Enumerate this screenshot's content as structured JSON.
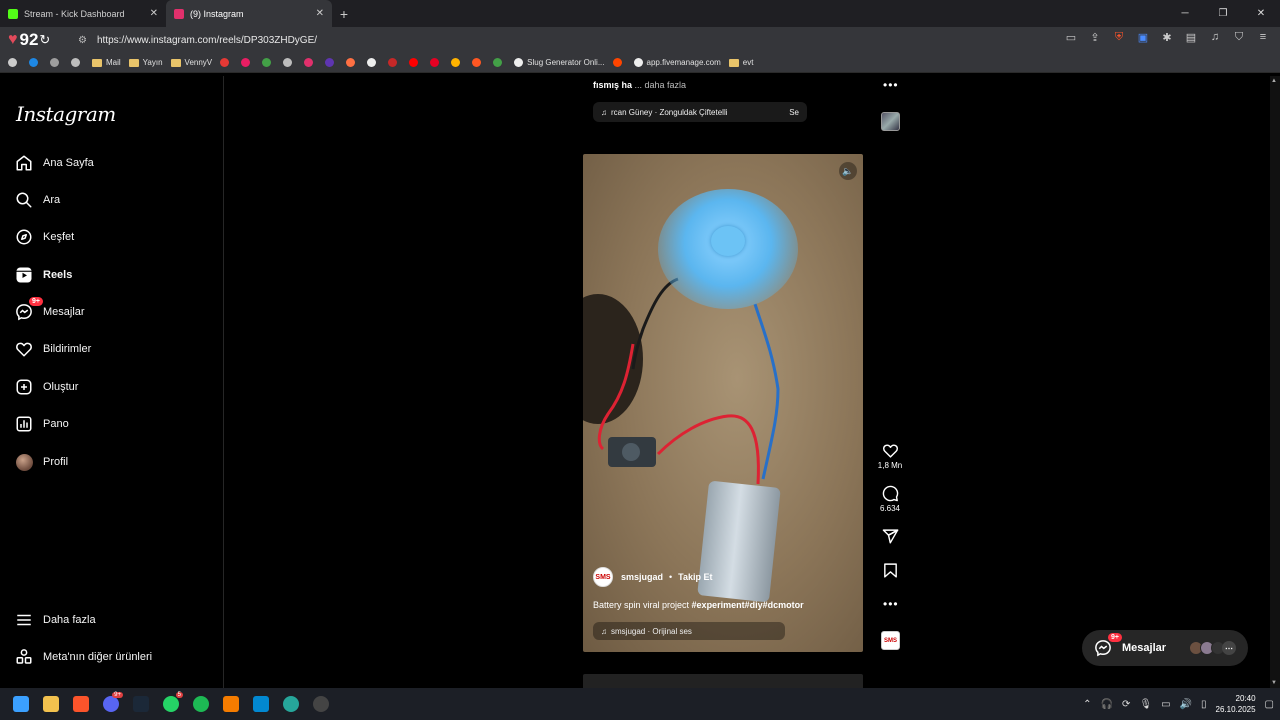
{
  "browser": {
    "tabs": [
      {
        "title": "Stream - Kick Dashboard",
        "favicon_color": "#53fc18",
        "active": false
      },
      {
        "title": "(9) Instagram",
        "favicon_color": "#e1306c",
        "active": true
      }
    ],
    "new_tab_label": "+",
    "shields_count": "92",
    "url": "https://www.instagram.com/reels/DP303ZHDyGE/",
    "bookmarks": [
      {
        "label": "",
        "icon": "apps-grid-icon",
        "color": "#cccccc"
      },
      {
        "label": "",
        "icon": "zte-icon",
        "color": "#1e88e5"
      },
      {
        "label": "",
        "icon": "play-icon",
        "color": "#9e9e9e"
      },
      {
        "label": "",
        "icon": "chrome-icon",
        "color": "#bdbdbd"
      },
      {
        "label": "Mail",
        "icon": "folder-icon",
        "color": "#e9c46a"
      },
      {
        "label": "Yayın",
        "icon": "folder-icon",
        "color": "#e9c46a"
      },
      {
        "label": "VennyV",
        "icon": "folder-icon",
        "color": "#e9c46a"
      },
      {
        "label": "",
        "icon": "a-icon",
        "color": "#e53935"
      },
      {
        "label": "",
        "icon": "bi-icon",
        "color": "#e91e63"
      },
      {
        "label": "",
        "icon": "plus-icon",
        "color": "#43a047"
      },
      {
        "label": "",
        "icon": "gamepad-icon",
        "color": "#bdbdbd"
      },
      {
        "label": "",
        "icon": "instagram-icon",
        "color": "#e1306c"
      },
      {
        "label": "",
        "icon": "circle-icon",
        "color": "#5e35b1"
      },
      {
        "label": "",
        "icon": "soundcloud-icon",
        "color": "#ff7043"
      },
      {
        "label": "",
        "icon": "x-icon",
        "color": "#eeeeee"
      },
      {
        "label": "",
        "icon": "bookmark-icon",
        "color": "#c62828"
      },
      {
        "label": "",
        "icon": "youtube-icon",
        "color": "#ff0000"
      },
      {
        "label": "",
        "icon": "pinterest-icon",
        "color": "#e60023"
      },
      {
        "label": "",
        "icon": "a-circle-icon",
        "color": "#ffb300"
      },
      {
        "label": "",
        "icon": "orange-icon",
        "color": "#ff5722"
      },
      {
        "label": "",
        "icon": "xbox-icon",
        "color": "#43a047"
      },
      {
        "label": "Slug Generator Onli...",
        "icon": "slug-icon",
        "color": "#eeeeee"
      },
      {
        "label": "",
        "icon": "reddit-icon",
        "color": "#ff4500"
      },
      {
        "label": "app.fivemanage.com",
        "icon": "fivemanage-icon",
        "color": "#eeeeee"
      },
      {
        "label": "evt",
        "icon": "folder-icon",
        "color": "#e9c46a"
      }
    ]
  },
  "sidebar": {
    "logo": "Instagram",
    "items": [
      {
        "label": "Ana Sayfa",
        "icon": "home-icon"
      },
      {
        "label": "Ara",
        "icon": "search-icon"
      },
      {
        "label": "Keşfet",
        "icon": "compass-icon"
      },
      {
        "label": "Reels",
        "icon": "reels-icon",
        "active": true
      },
      {
        "label": "Mesajlar",
        "icon": "messenger-icon",
        "badge": "9+"
      },
      {
        "label": "Bildirimler",
        "icon": "heart-icon"
      },
      {
        "label": "Oluştur",
        "icon": "create-icon"
      },
      {
        "label": "Pano",
        "icon": "dashboard-icon"
      },
      {
        "label": "Profil",
        "icon": "avatar"
      }
    ],
    "bottom": [
      {
        "label": "Daha fazla",
        "icon": "menu-icon"
      },
      {
        "label": "Meta'nın diğer ürünleri",
        "icon": "meta-apps-icon"
      }
    ]
  },
  "prev_reel": {
    "caption_start": "fısmış ha",
    "more_label": "... daha fazla",
    "audio": "rcan Güney · Zonguldak Çiftetelli",
    "audio_suffix": "Se"
  },
  "reel": {
    "author": "smsjugad",
    "author_avatar_text": "SMS",
    "follow_label": "Takip Et",
    "caption_text": "Battery spin viral project ",
    "caption_tags": "#experiment#diy#dcmotor",
    "audio": "smsjugad · Orijinal ses",
    "likes": "1,8 Mn",
    "comments": "6.634"
  },
  "messages_pill": {
    "label": "Mesajlar",
    "badge": "9+"
  },
  "taskbar": {
    "apps": [
      {
        "icon": "windows-icon",
        "color": "#3ba0ff"
      },
      {
        "icon": "explorer-icon",
        "color": "#f2c14e"
      },
      {
        "icon": "brave-icon",
        "color": "#fb542b"
      },
      {
        "icon": "discord-icon",
        "color": "#5865f2",
        "badge": "9+"
      },
      {
        "icon": "steam-icon",
        "color": "#1b2838"
      },
      {
        "icon": "whatsapp-icon",
        "color": "#25d366",
        "badge": "5"
      },
      {
        "icon": "spotify-icon",
        "color": "#1db954"
      },
      {
        "icon": "app-a-icon",
        "color": "#f57c00"
      },
      {
        "icon": "rdp-icon",
        "color": "#0288d1"
      },
      {
        "icon": "app-circle-icon",
        "color": "#26a69a"
      },
      {
        "icon": "obs-icon",
        "color": "#444444"
      }
    ],
    "time": "20:40",
    "date": "26.10.2025"
  }
}
